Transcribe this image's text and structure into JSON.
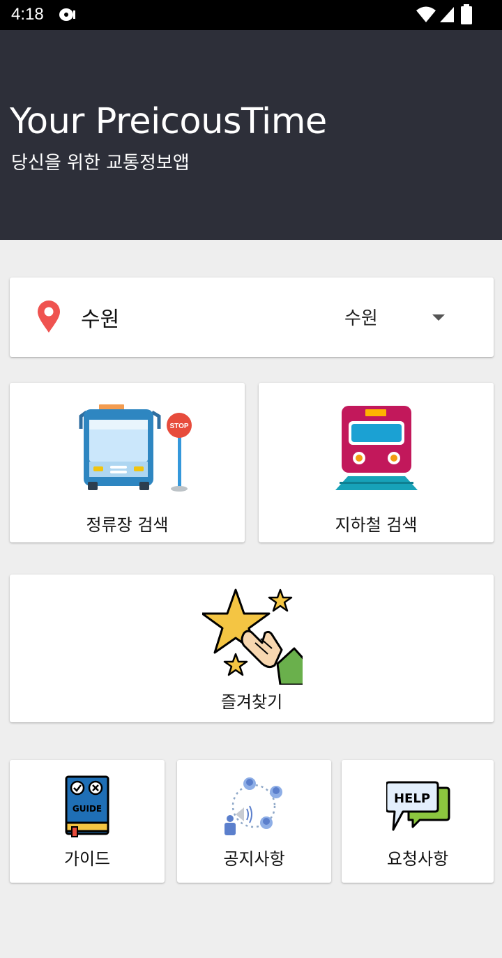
{
  "status_bar": {
    "time": "4:18",
    "icons": [
      "media-cast-icon",
      "wifi-icon",
      "signal-icon",
      "battery-icon"
    ]
  },
  "header": {
    "title": "Your PreicousTime",
    "subtitle": "당신을 위한 교통정보앱"
  },
  "region": {
    "icon": "location-pin-icon",
    "current_city": "수원",
    "select_value": "수원"
  },
  "menu": {
    "bus_stop_search": {
      "label": "정류장 검색",
      "icon": "bus-stop-icon"
    },
    "subway_search": {
      "label": "지하철 검색",
      "icon": "subway-train-icon"
    },
    "favorites": {
      "label": "즐겨찾기",
      "icon": "star-hand-icon"
    },
    "guide": {
      "label": "가이드",
      "icon": "guide-book-icon"
    },
    "notice": {
      "label": "공지사항",
      "icon": "announcement-icon"
    },
    "request": {
      "label": "요청사항",
      "icon": "help-bubble-icon"
    }
  },
  "colors": {
    "header_bg": "#2d2f39",
    "page_bg": "#eeeeee",
    "pin_red": "#ef5350"
  }
}
